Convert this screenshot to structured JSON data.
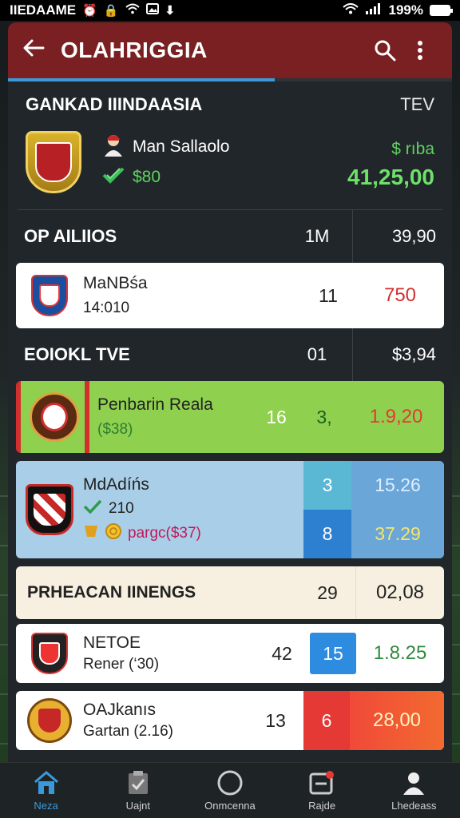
{
  "status_bar": {
    "carrier": "IIEDAAME",
    "battery_pct": "199%"
  },
  "appbar": {
    "title": "OLAHRIGGIA",
    "progress": 0.6
  },
  "summary": {
    "league": "GANKAD IIINDAASIA",
    "league_right": "TEV",
    "team": "Man Sallaolo",
    "amount": "$80",
    "price_label": "$ rıba",
    "price_big": "41,25,00"
  },
  "section1": {
    "label": "OP AILIIOS",
    "col1": "1M",
    "col2": "39,90"
  },
  "card1": {
    "name": "MaNBśa",
    "sub": "14:010",
    "num": "11",
    "odds": "750"
  },
  "section2": {
    "label": "EOIOKL TVE",
    "col1": "01",
    "col2": "$3,94"
  },
  "card2": {
    "name": "Penbarin Reala",
    "sub": "($38)",
    "num_a": "16",
    "num_b": "3,",
    "odds": "1.9,20"
  },
  "card3": {
    "name": "MdAdíńs",
    "line2": "210",
    "line3": "pargc($37)",
    "top_num": "3",
    "bottom_num": "8",
    "top_odds": "15.26",
    "bottom_odds": "37.29"
  },
  "section3": {
    "label": "PRHEACAN IINENGS",
    "col1": "29",
    "col2": "02,08"
  },
  "card4": {
    "name": "NETOE",
    "sub": "Rener (‘30)",
    "num": "42",
    "box": "15",
    "odds": "1.8.25"
  },
  "card5": {
    "name": "OAJkanıs",
    "sub": "Gartan (2.16)",
    "num": "13",
    "box": "6",
    "odds": "28,00"
  },
  "nav": [
    {
      "label": "Neza",
      "icon": "home-icon"
    },
    {
      "label": "Uajnt",
      "icon": "clipboard-icon"
    },
    {
      "label": "Onmcenna",
      "icon": "circle-icon"
    },
    {
      "label": "Rajde",
      "icon": "inbox-icon"
    },
    {
      "label": "Lhedeass",
      "icon": "profile-icon"
    }
  ],
  "colors": {
    "appbar": "#7a1f22",
    "accent": "#3a9ad9",
    "green_card": "#8fd14f",
    "blue_card": "#a9cfe8",
    "red_box": "#e53935"
  }
}
